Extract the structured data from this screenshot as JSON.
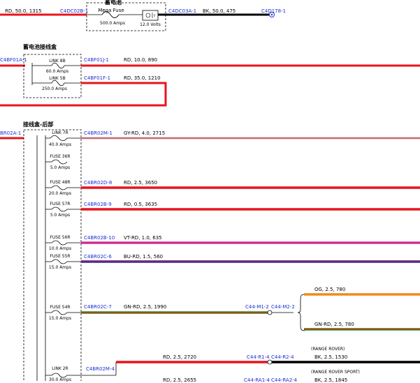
{
  "sections": {
    "top_title": "蓄电池",
    "junction_box_title": "蓄电池接线盒",
    "rear_box_title": "接线盒-后部"
  },
  "top_row": {
    "left_wire": "RD, 50.0, 1315",
    "left_connector": "C4DC02B-1",
    "fuse_name": "Mega Fuse",
    "fuse_rating": "500.0 Amps",
    "battery_voltage": "12.0 Volts",
    "right_connector": "C4DC03A-1",
    "right_wire": "BK, 50.0, 475",
    "ground_connector": "C4D178-1"
  },
  "junction_box": {
    "input_connector": "C4BF01A-1",
    "links": [
      {
        "name": "LINK 8B",
        "rating": "60.0 Amps",
        "connector": "C4BF01J-1",
        "wire": "RD, 10.0, 890"
      },
      {
        "name": "LINK 5B",
        "rating": "250.0 Amps",
        "connector": "C4BF01F-1",
        "wire": "RD, 35.0, 1210"
      }
    ]
  },
  "rear_box": {
    "input_connector": "BR02A-1",
    "fuses": [
      {
        "name": "LINK 7R",
        "rating": "40.0 Amps",
        "connector": "C4BR02M-1",
        "wire": "GY-RD, 4.0, 2715"
      },
      {
        "name": "FUSE 36R",
        "rating": "5.0 Amps",
        "connector": "",
        "wire": ""
      },
      {
        "name": "FUSE 48R",
        "rating": "20.0 Amps",
        "connector": "C4BR02D-8",
        "wire": "RD, 2.5, 3650"
      },
      {
        "name": "FUSE 57R",
        "rating": "5.0 Amps",
        "connector": "C4BR02B-9",
        "wire": "RD, 0.5, 3635"
      },
      {
        "name": "FUSE 56R",
        "rating": "10.0 Amps",
        "connector": "C4BR02B-10",
        "wire": "VT-RD, 1.0, 635"
      },
      {
        "name": "FUSE 55R",
        "rating": "15.0 Amps",
        "connector": "C4BR02C-6",
        "wire": "BU-RD, 1.5, 560"
      },
      {
        "name": "FUSE 54R",
        "rating": "15.0 Amps",
        "connector": "C4BR02C-7",
        "wire": "GN-RD, 2.5, 1990"
      },
      {
        "name": "LINK 2R",
        "rating": "30.0 Amps",
        "connector": "C4BR02M-4",
        "wire": "RD, 2.5, 2720"
      }
    ],
    "splice": {
      "conn_a": "C44-M1-2",
      "conn_b": "C44-M2-2",
      "branch_top_wire": "OG, 2.5, 780",
      "branch_bottom_wire": "GN-RD, 2.5, 780"
    },
    "range_rover": {
      "label": "(RANGE ROVER)",
      "conn_a": "C44-R1-4",
      "conn_b": "C44-R2-4",
      "wire": "BK, 2.5, 1530"
    },
    "range_rover_sport": {
      "label": "(RANGE ROVER SPORT)",
      "conn_a": "C44-RA1-4",
      "conn_b": "C44-RA2-4",
      "wire": "BK, 2.5, 1845",
      "red_wire": "RD, 2.5, 2655"
    }
  },
  "colors": {
    "red": "#e8141c",
    "black": "#000000",
    "gray_red": "#b8b8b8",
    "violet_red": "#c040c8",
    "blue_red": "#1c2aa8",
    "green_red": "#3e8a1c",
    "orange": "#f28a1a",
    "connector_blue": "#1a2fd0"
  }
}
